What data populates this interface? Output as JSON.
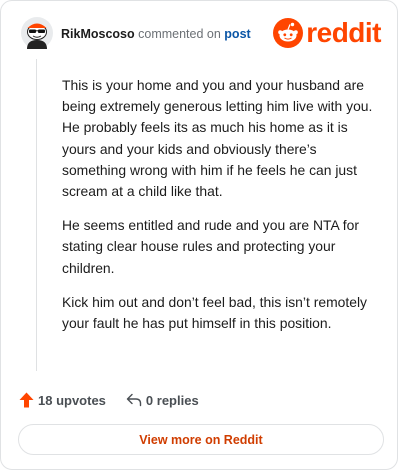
{
  "header": {
    "author": "RikMoscoso",
    "commented_text": "commented on",
    "post_link": "post",
    "logo_text": "reddit",
    "avatar_icon": "snoo-avatar-sunglasses",
    "logo_icon": "reddit-snoo-logo"
  },
  "comment": {
    "paragraphs": [
      "This is your home and you and your husband are being extremely generous letting him live with you. He probably feels its as much his home as it is yours and your kids and obviously there’s something wrong with him if he feels he can just scream at a child like that.",
      "He seems entitled and rude and you are NTA for stating clear house rules and protecting your children.",
      "Kick him out and don’t feel bad, this isn’t remotely your fault he has put himself in this position."
    ]
  },
  "actions": {
    "upvotes": "18 upvotes",
    "replies": "0 replies",
    "upvote_icon": "upvote-arrow-icon",
    "reply_icon": "reply-arrow-icon"
  },
  "footer": {
    "view_more": "View more on Reddit"
  },
  "colors": {
    "brand": "#ff4500",
    "link": "#0b56a6",
    "button_text": "#d03d00"
  }
}
